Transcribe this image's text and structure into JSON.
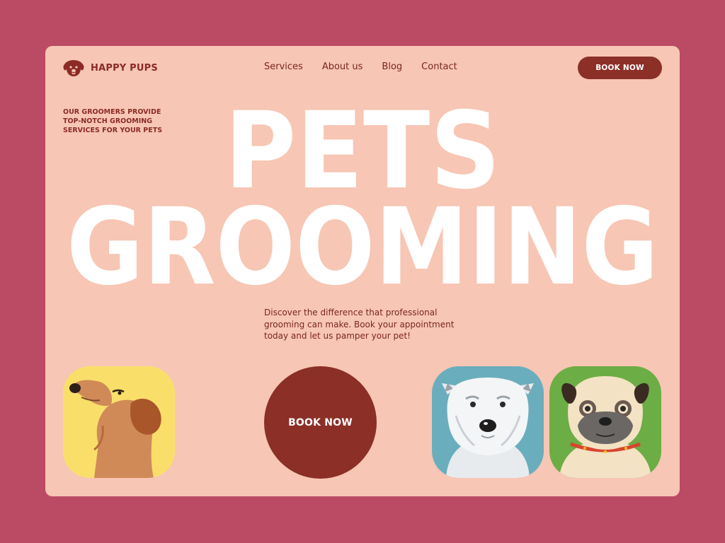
{
  "brand": {
    "name": "HAPPY PUPS",
    "logo_icon": "dog-face-icon"
  },
  "nav": {
    "items": [
      "Services",
      "About us",
      "Blog",
      "Contact"
    ]
  },
  "header": {
    "cta_label": "BOOK NOW"
  },
  "tagline": {
    "lines": [
      "OUR GROOMERS PROVIDE",
      "TOP-NOTCH GROOMING",
      "SERVICES FOR YOUR PETS"
    ]
  },
  "hero": {
    "line1": "PETS",
    "line2": "GROOMING"
  },
  "description": {
    "text": "Discover the difference that professional grooming can make. Book your appointment today and let us pamper your pet!"
  },
  "cta": {
    "circle_label": "BOOK NOW"
  },
  "pets": [
    {
      "name": "dachshund",
      "icon": "dachshund-illustration",
      "bg": "#f9df6a"
    },
    {
      "name": "westie",
      "icon": "westie-illustration",
      "bg": "#6aaebd"
    },
    {
      "name": "pug",
      "icon": "pug-illustration",
      "bg": "#6cad45"
    }
  ],
  "colors": {
    "page_bg": "#bb4a64",
    "card_bg": "#f7c6b4",
    "accent": "#8b2f27",
    "hero_text": "#ffffff"
  }
}
